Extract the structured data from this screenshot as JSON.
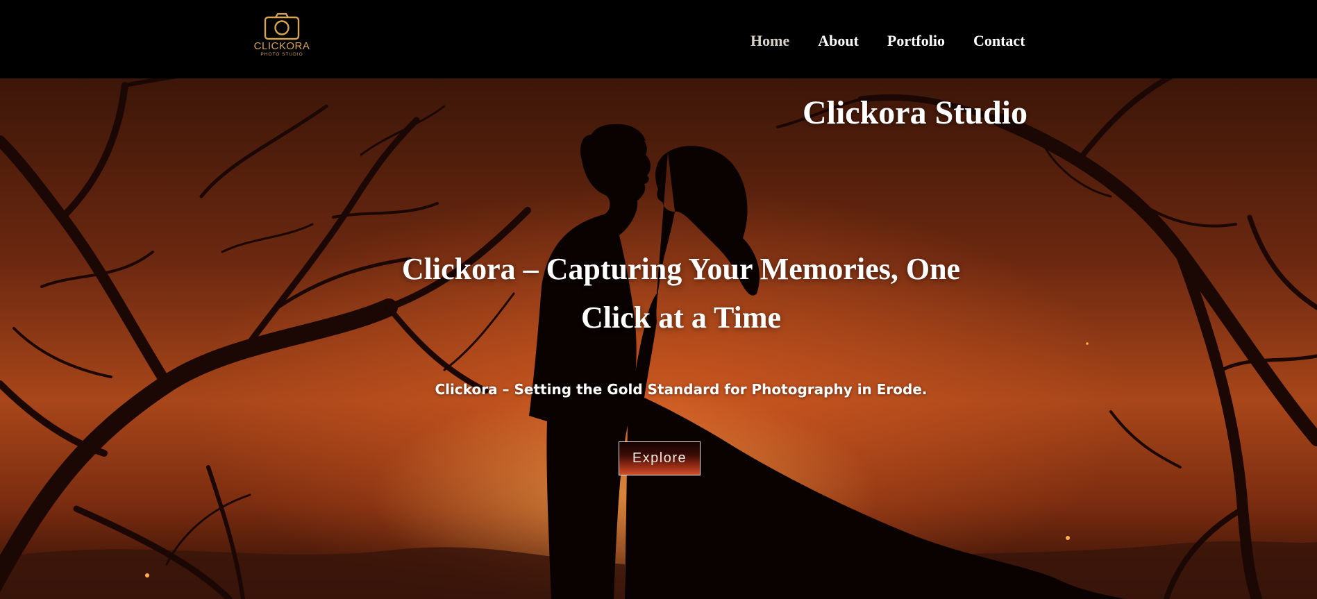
{
  "brand": {
    "name": "CLICKORA",
    "tagline": "PHOTO STUDIO",
    "accent_color": "#d6a452",
    "icon": "camera-icon"
  },
  "nav": {
    "items": [
      {
        "label": "Home",
        "active": true
      },
      {
        "label": "About",
        "active": false
      },
      {
        "label": "Portfolio",
        "active": false
      },
      {
        "label": "Contact",
        "active": false
      }
    ]
  },
  "hero": {
    "studio_title": "Clickora Studio",
    "headline": "Clickora – Capturing Your Memories, One Click at a Time",
    "subheadline": "Clickora – Setting the Gold Standard for Photography in Erode.",
    "cta_label": "Explore",
    "background_colors": [
      "#3c1608",
      "#a8461a",
      "#2a0d05"
    ]
  }
}
